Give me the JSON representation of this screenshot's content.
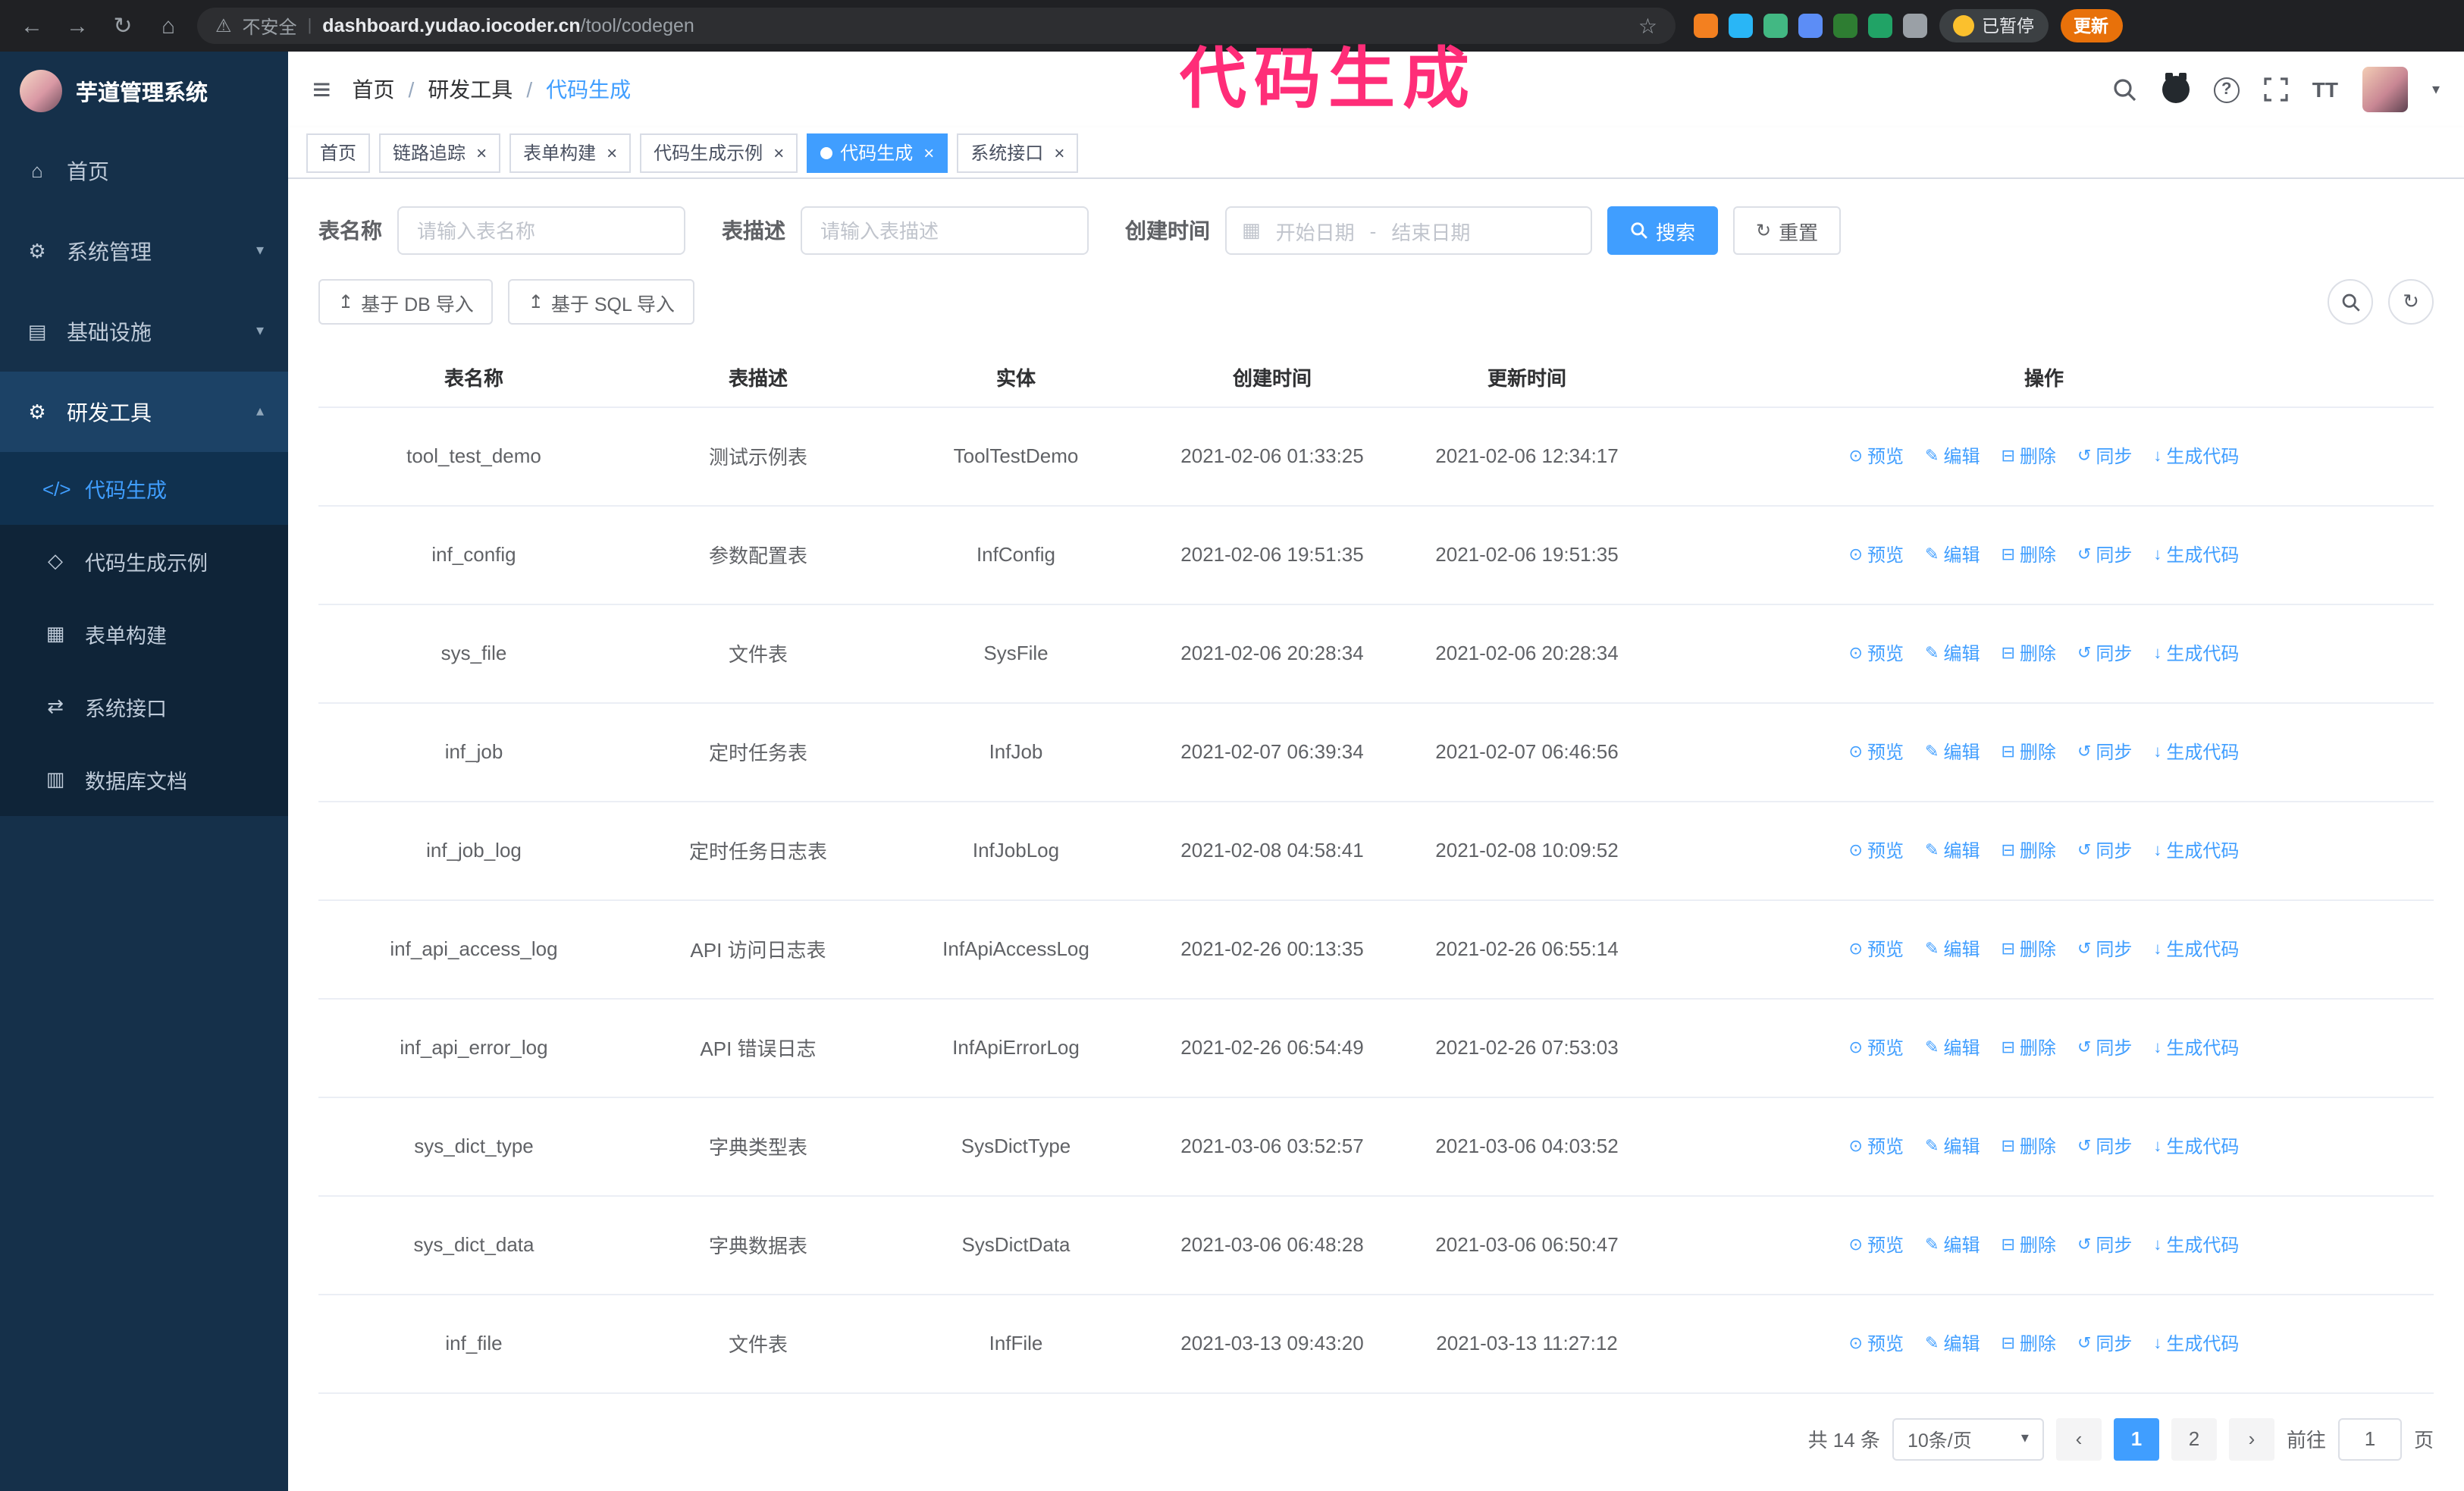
{
  "annotation": {
    "text": "代码生成",
    "color": "#ff2d78"
  },
  "browser": {
    "security_label": "不安全",
    "url_host": "dashboard.yudao.iocoder.cn",
    "url_path": "/tool/codegen",
    "paused_badge": "已暂停",
    "update_button": "更新",
    "extensions": [
      {
        "name": "extension-orange-icon",
        "color": "#f38020"
      },
      {
        "name": "extension-water-drop-icon",
        "color": "#29b6f6"
      },
      {
        "name": "vue-devtools-icon",
        "color": "#42b883"
      },
      {
        "name": "extension-people-icon",
        "color": "#5c8df6"
      },
      {
        "name": "extension-screen-icon",
        "color": "#2e7d32"
      },
      {
        "name": "extension-leaf-icon",
        "color": "#21a366"
      },
      {
        "name": "extensions-puzzle-icon",
        "color": "#9aa0a6"
      }
    ]
  },
  "icons": {
    "back": "←",
    "forward": "→",
    "reload": "↻",
    "home": "⌂",
    "warning": "⚠",
    "star": "☆",
    "pipe": "|",
    "hamburger": "≡",
    "slash": "/",
    "caret_down": "▾",
    "close": "×",
    "dot": "•",
    "calendar": "▦",
    "refresh": "↻",
    "upload": "↥",
    "question": "?",
    "font_size": "ТT",
    "prev": "‹",
    "next": "›",
    "dash": "-"
  },
  "sidebar": {
    "logo_title": "芋道管理系统",
    "items": [
      {
        "id": "home",
        "label": "首页",
        "icon": "dashboard-icon",
        "glyph": "⌂",
        "chevron": ""
      },
      {
        "id": "system-mgmt",
        "label": "系统管理",
        "icon": "gear-icon",
        "glyph": "⚙",
        "chevron": "▾"
      },
      {
        "id": "infrastructure",
        "label": "基础设施",
        "icon": "infrastructure-icon",
        "glyph": "▤",
        "chevron": "▾"
      },
      {
        "id": "dev-tools",
        "label": "研发工具",
        "icon": "dev-tools-icon",
        "glyph": "⚙",
        "chevron": "▴",
        "open": true
      }
    ],
    "subitems": [
      {
        "id": "codegen",
        "label": "代码生成",
        "icon": "code-icon",
        "glyph": "</>",
        "active": true
      },
      {
        "id": "codegen-example",
        "label": "代码生成示例",
        "icon": "example-icon",
        "glyph": "◇"
      },
      {
        "id": "form-builder",
        "label": "表单构建",
        "icon": "form-icon",
        "glyph": "▦"
      },
      {
        "id": "system-api",
        "label": "系统接口",
        "icon": "api-icon",
        "glyph": "⇄"
      },
      {
        "id": "db-doc",
        "label": "数据库文档",
        "icon": "database-doc-icon",
        "glyph": "▥"
      }
    ]
  },
  "header": {
    "breadcrumb": [
      {
        "label": "首页"
      },
      {
        "label": "研发工具"
      },
      {
        "label": "代码生成"
      }
    ]
  },
  "tabs": [
    {
      "id": "home",
      "label": "首页",
      "closable": false,
      "active": false
    },
    {
      "id": "tracer",
      "label": "链路追踪",
      "closable": true,
      "active": false
    },
    {
      "id": "form-builder",
      "label": "表单构建",
      "closable": true,
      "active": false
    },
    {
      "id": "codegen-example",
      "label": "代码生成示例",
      "closable": true,
      "active": false
    },
    {
      "id": "codegen",
      "label": "代码生成",
      "closable": true,
      "active": true
    },
    {
      "id": "system-api",
      "label": "系统接口",
      "closable": true,
      "active": false
    }
  ],
  "filters": {
    "table_name_label": "表名称",
    "table_name_placeholder": "请输入表名称",
    "table_desc_label": "表描述",
    "table_desc_placeholder": "请输入表描述",
    "create_time_label": "创建时间",
    "date_start_placeholder": "开始日期",
    "date_separator": "-",
    "date_end_placeholder": "结束日期",
    "search_button": "搜索",
    "reset_button": "重置"
  },
  "toolbar": {
    "import_db_button": "基于 DB 导入",
    "import_sql_button": "基于 SQL 导入"
  },
  "table": {
    "columns": [
      "表名称",
      "表描述",
      "实体",
      "创建时间",
      "更新时间",
      "操作"
    ],
    "actions": [
      "预览",
      "编辑",
      "删除",
      "同步",
      "生成代码"
    ],
    "action_icons": [
      {
        "name": "eye-icon",
        "glyph": "⊙"
      },
      {
        "name": "edit-icon",
        "glyph": "✎"
      },
      {
        "name": "trash-icon",
        "glyph": "⊟"
      },
      {
        "name": "sync-icon",
        "glyph": "↺"
      },
      {
        "name": "download-code-icon",
        "glyph": "↓"
      }
    ],
    "rows": [
      {
        "name": "tool_test_demo",
        "desc": "测试示例表",
        "entity": "ToolTestDemo",
        "created": "2021-02-06 01:33:25",
        "updated": "2021-02-06 12:34:17"
      },
      {
        "name": "inf_config",
        "desc": "参数配置表",
        "entity": "InfConfig",
        "created": "2021-02-06 19:51:35",
        "updated": "2021-02-06 19:51:35"
      },
      {
        "name": "sys_file",
        "desc": "文件表",
        "entity": "SysFile",
        "created": "2021-02-06 20:28:34",
        "updated": "2021-02-06 20:28:34"
      },
      {
        "name": "inf_job",
        "desc": "定时任务表",
        "entity": "InfJob",
        "created": "2021-02-07 06:39:34",
        "updated": "2021-02-07 06:46:56"
      },
      {
        "name": "inf_job_log",
        "desc": "定时任务日志表",
        "entity": "InfJobLog",
        "created": "2021-02-08 04:58:41",
        "updated": "2021-02-08 10:09:52"
      },
      {
        "name": "inf_api_access_log",
        "desc": "API 访问日志表",
        "entity": "InfApiAccessLog",
        "created": "2021-02-26 00:13:35",
        "updated": "2021-02-26 06:55:14"
      },
      {
        "name": "inf_api_error_log",
        "desc": "API 错误日志",
        "entity": "InfApiErrorLog",
        "created": "2021-02-26 06:54:49",
        "updated": "2021-02-26 07:53:03"
      },
      {
        "name": "sys_dict_type",
        "desc": "字典类型表",
        "entity": "SysDictType",
        "created": "2021-03-06 03:52:57",
        "updated": "2021-03-06 04:03:52"
      },
      {
        "name": "sys_dict_data",
        "desc": "字典数据表",
        "entity": "SysDictData",
        "created": "2021-03-06 06:48:28",
        "updated": "2021-03-06 06:50:47"
      },
      {
        "name": "inf_file",
        "desc": "文件表",
        "entity": "InfFile",
        "created": "2021-03-13 09:43:20",
        "updated": "2021-03-13 11:27:12"
      }
    ]
  },
  "pagination": {
    "total_label": "共 14 条",
    "page_size": "10条/页",
    "pages": [
      "1",
      "2"
    ],
    "active_page": "1",
    "goto_label": "前往",
    "goto_value": "1",
    "goto_suffix": "页"
  },
  "colors": {
    "accent_blue": "#409eff",
    "annotation_pink": "#ff2d78",
    "chrome_bg": "#202124",
    "sidebar_bg": "#15304a",
    "submenu_bg": "#0f2438",
    "update_orange": "#e8710a",
    "border_gray": "#dcdfe6",
    "row_divider": "#ebeef5"
  }
}
